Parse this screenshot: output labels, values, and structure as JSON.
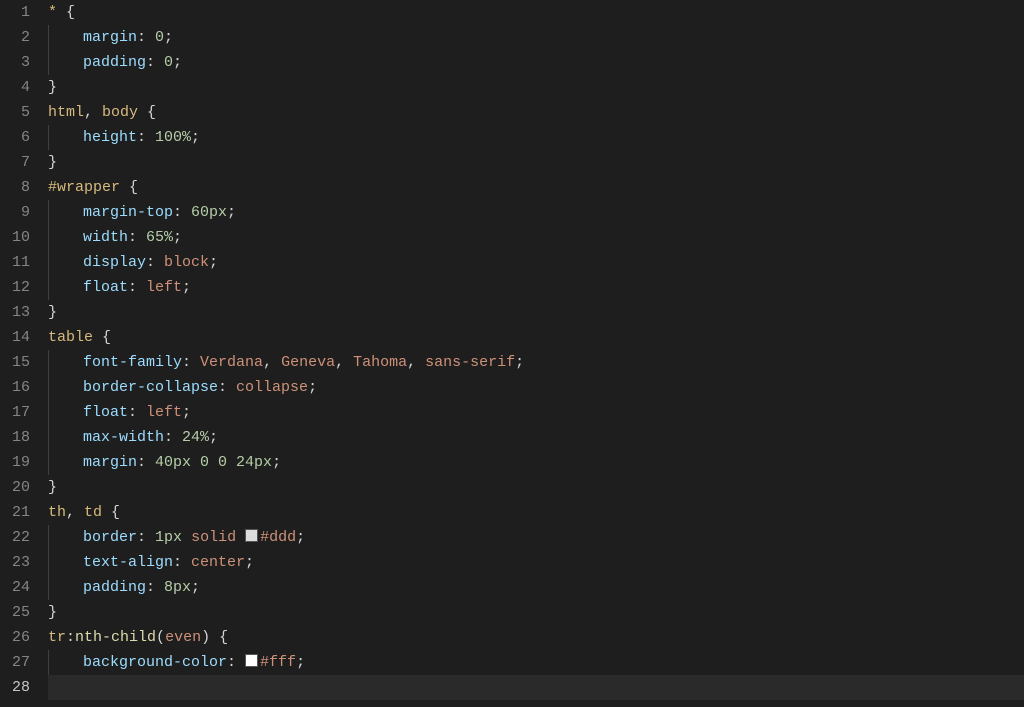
{
  "colors": {
    "background": "#1e1e1e",
    "gutter": "#858585",
    "selector": "#d7ba7d",
    "property": "#9cdcfe",
    "number": "#b5cea8",
    "value": "#ce9178",
    "function": "#dcdcaa",
    "default": "#d4d4d4",
    "swatch_ddd": "#dddddd",
    "swatch_fff": "#ffffff"
  },
  "activeLine": 28,
  "lines": [
    {
      "n": 1,
      "indent": 0,
      "tokens": [
        [
          "sel",
          "* "
        ],
        [
          "brace",
          "{"
        ]
      ]
    },
    {
      "n": 2,
      "indent": 1,
      "tokens": [
        [
          "prop",
          "margin"
        ],
        [
          "punc",
          ": "
        ],
        [
          "num",
          "0"
        ],
        [
          "punc",
          ";"
        ]
      ]
    },
    {
      "n": 3,
      "indent": 1,
      "tokens": [
        [
          "prop",
          "padding"
        ],
        [
          "punc",
          ": "
        ],
        [
          "num",
          "0"
        ],
        [
          "punc",
          ";"
        ]
      ]
    },
    {
      "n": 4,
      "indent": 0,
      "tokens": [
        [
          "brace",
          "}"
        ]
      ]
    },
    {
      "n": 5,
      "indent": 0,
      "tokens": [
        [
          "sel",
          "html"
        ],
        [
          "punc",
          ", "
        ],
        [
          "sel",
          "body "
        ],
        [
          "brace",
          "{"
        ]
      ]
    },
    {
      "n": 6,
      "indent": 1,
      "tokens": [
        [
          "prop",
          "height"
        ],
        [
          "punc",
          ": "
        ],
        [
          "num",
          "100%"
        ],
        [
          "punc",
          ";"
        ]
      ]
    },
    {
      "n": 7,
      "indent": 0,
      "tokens": [
        [
          "brace",
          "}"
        ]
      ]
    },
    {
      "n": 8,
      "indent": 0,
      "tokens": [
        [
          "sel",
          "#wrapper "
        ],
        [
          "brace",
          "{"
        ]
      ]
    },
    {
      "n": 9,
      "indent": 1,
      "tokens": [
        [
          "prop",
          "margin-top"
        ],
        [
          "punc",
          ": "
        ],
        [
          "num",
          "60px"
        ],
        [
          "punc",
          ";"
        ]
      ]
    },
    {
      "n": 10,
      "indent": 1,
      "tokens": [
        [
          "prop",
          "width"
        ],
        [
          "punc",
          ": "
        ],
        [
          "num",
          "65%"
        ],
        [
          "punc",
          ";"
        ]
      ]
    },
    {
      "n": 11,
      "indent": 1,
      "tokens": [
        [
          "prop",
          "display"
        ],
        [
          "punc",
          ": "
        ],
        [
          "val",
          "block"
        ],
        [
          "punc",
          ";"
        ]
      ]
    },
    {
      "n": 12,
      "indent": 1,
      "tokens": [
        [
          "prop",
          "float"
        ],
        [
          "punc",
          ": "
        ],
        [
          "val",
          "left"
        ],
        [
          "punc",
          ";"
        ]
      ]
    },
    {
      "n": 13,
      "indent": 0,
      "tokens": [
        [
          "brace",
          "}"
        ]
      ]
    },
    {
      "n": 14,
      "indent": 0,
      "tokens": [
        [
          "sel",
          "table "
        ],
        [
          "brace",
          "{"
        ]
      ]
    },
    {
      "n": 15,
      "indent": 1,
      "tokens": [
        [
          "prop",
          "font-family"
        ],
        [
          "punc",
          ": "
        ],
        [
          "val",
          "Verdana"
        ],
        [
          "punc",
          ", "
        ],
        [
          "val",
          "Geneva"
        ],
        [
          "punc",
          ", "
        ],
        [
          "val",
          "Tahoma"
        ],
        [
          "punc",
          ", "
        ],
        [
          "val",
          "sans-serif"
        ],
        [
          "punc",
          ";"
        ]
      ]
    },
    {
      "n": 16,
      "indent": 1,
      "tokens": [
        [
          "prop",
          "border-collapse"
        ],
        [
          "punc",
          ": "
        ],
        [
          "val",
          "collapse"
        ],
        [
          "punc",
          ";"
        ]
      ]
    },
    {
      "n": 17,
      "indent": 1,
      "tokens": [
        [
          "prop",
          "float"
        ],
        [
          "punc",
          ": "
        ],
        [
          "val",
          "left"
        ],
        [
          "punc",
          ";"
        ]
      ]
    },
    {
      "n": 18,
      "indent": 1,
      "tokens": [
        [
          "prop",
          "max-width"
        ],
        [
          "punc",
          ": "
        ],
        [
          "num",
          "24%"
        ],
        [
          "punc",
          ";"
        ]
      ]
    },
    {
      "n": 19,
      "indent": 1,
      "tokens": [
        [
          "prop",
          "margin"
        ],
        [
          "punc",
          ": "
        ],
        [
          "num",
          "40px 0 0 24px"
        ],
        [
          "punc",
          ";"
        ]
      ]
    },
    {
      "n": 20,
      "indent": 0,
      "tokens": [
        [
          "brace",
          "}"
        ]
      ]
    },
    {
      "n": 21,
      "indent": 0,
      "tokens": [
        [
          "sel",
          "th"
        ],
        [
          "punc",
          ", "
        ],
        [
          "sel",
          "td "
        ],
        [
          "brace",
          "{"
        ]
      ]
    },
    {
      "n": 22,
      "indent": 1,
      "tokens": [
        [
          "prop",
          "border"
        ],
        [
          "punc",
          ": "
        ],
        [
          "num",
          "1px"
        ],
        [
          "punc",
          " "
        ],
        [
          "val",
          "solid"
        ],
        [
          "punc",
          " "
        ],
        [
          "swatch",
          "swatch_ddd"
        ],
        [
          "hex",
          "#ddd"
        ],
        [
          "punc",
          ";"
        ]
      ]
    },
    {
      "n": 23,
      "indent": 1,
      "tokens": [
        [
          "prop",
          "text-align"
        ],
        [
          "punc",
          ": "
        ],
        [
          "val",
          "center"
        ],
        [
          "punc",
          ";"
        ]
      ]
    },
    {
      "n": 24,
      "indent": 1,
      "tokens": [
        [
          "prop",
          "padding"
        ],
        [
          "punc",
          ": "
        ],
        [
          "num",
          "8px"
        ],
        [
          "punc",
          ";"
        ]
      ]
    },
    {
      "n": 25,
      "indent": 0,
      "tokens": [
        [
          "brace",
          "}"
        ]
      ]
    },
    {
      "n": 26,
      "indent": 0,
      "tokens": [
        [
          "sel",
          "tr"
        ],
        [
          "punc",
          ":"
        ],
        [
          "func",
          "nth-child"
        ],
        [
          "paren",
          "("
        ],
        [
          "val",
          "even"
        ],
        [
          "paren",
          ") "
        ],
        [
          "brace",
          "{"
        ]
      ]
    },
    {
      "n": 27,
      "indent": 1,
      "tokens": [
        [
          "prop",
          "background-color"
        ],
        [
          "punc",
          ": "
        ],
        [
          "swatch",
          "swatch_fff"
        ],
        [
          "hex",
          "#fff"
        ],
        [
          "punc",
          ";"
        ]
      ]
    },
    {
      "n": 28,
      "indent": 0,
      "tokens": [
        [
          "brace",
          "}"
        ]
      ]
    }
  ]
}
